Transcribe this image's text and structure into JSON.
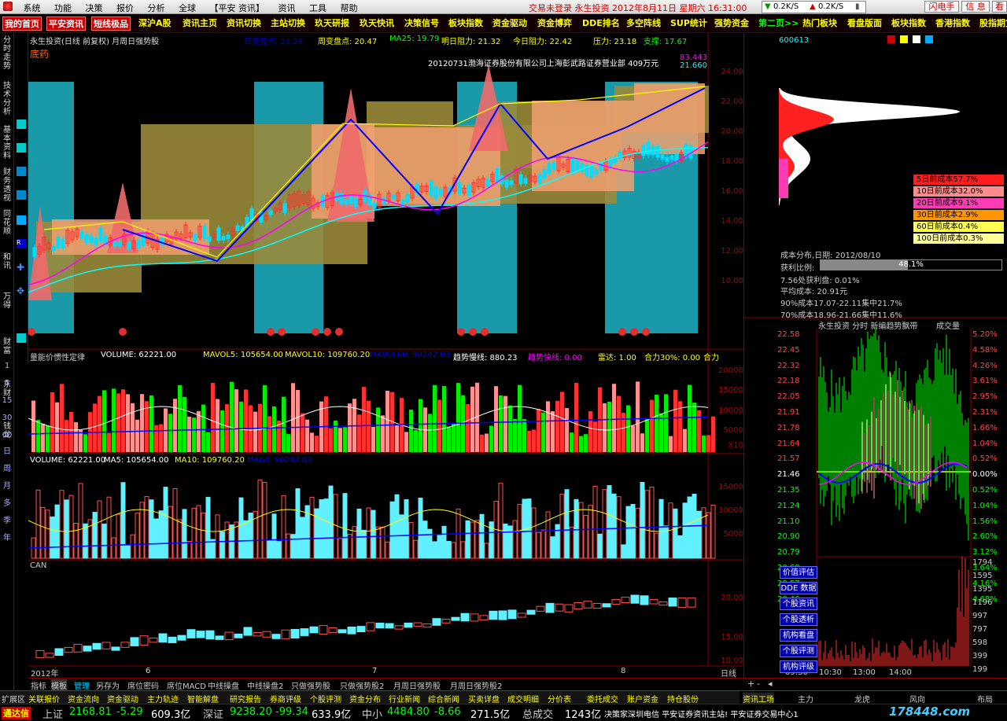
{
  "menu": {
    "items": [
      "系统",
      "功能",
      "决策",
      "报价",
      "分析",
      "全球",
      "【平安 资讯】",
      "资讯",
      "工具",
      "帮助"
    ],
    "status": "交易未登录  永生投资  2012年8月11日 星期六  16:31:00",
    "net_up": "0.2K/S",
    "net_down": "0.2K/S",
    "btn_flash": "闪电手",
    "btn_msg": "信 息",
    "btn_more": "看"
  },
  "toolbar": {
    "items": [
      "我的首页",
      "平安资讯",
      "短线极品",
      "深沪A股",
      "资讯主页",
      "资讯切换",
      "主站切换",
      "玖天研报",
      "玖天快讯",
      "决策信号",
      "板块指数",
      "资金驱动",
      "资金博弈",
      "DDE排名",
      "多空阵线",
      "SUP统计",
      "强势资金",
      "第二页>>",
      "热门板块",
      "看盘版面",
      "板块指数",
      "香港指数",
      "股指期货"
    ]
  },
  "left_tabs": [
    "分时走势",
    "技术分析",
    "基本资料",
    "财务透视",
    "同花顺",
    "和讯",
    "万得",
    "财富",
    "东财",
    "钱龙"
  ],
  "left_nums": [
    "1",
    "5",
    "15",
    "30",
    "60",
    "日",
    "周",
    "月",
    "多",
    "季",
    "年"
  ],
  "chart_header": {
    "title": "永生投资(日线 前复权) 月周日强势股",
    "sub": "底药",
    "daily": "日变盘点: 21.29",
    "weekly": "周变盘点: 20.47",
    "ma25": "MA25: 19.79",
    "resist_tomorrow": "明日阻力: 21.32",
    "resist_today": "今日阻力: 22.42",
    "pressure": "压力: 23.18",
    "support": "支撑: 17.67",
    "annotation": "20120731渤海证券股份有限公司上海彭武路证券营业部  409万元",
    "hi_label": "83.443",
    "hi2": "21.660"
  },
  "vol_header": {
    "label": "量能价惯性定律",
    "vol": "VOLUME: 62221.00",
    "mavol5": "MAVOL5: 105654.00",
    "mavol10": "MAVOL10: 109760.20",
    "mavol60": "MAVOL60: 90242.03",
    "slow": "趋势慢线: 880.23",
    "fast": "趋势快线: 0.00",
    "radar": "雷达: 1.00",
    "force": "合力30%: 0.00",
    "he": "合力"
  },
  "vol2_header": {
    "vol": "VOLUME: 62221.00",
    "ma5": "MA5: 105654.00",
    "ma10": "MA10: 109760.20",
    "ma60": "MA60: 90242.03"
  },
  "can_label": "CAN",
  "x_axis": {
    "year": "2012年",
    "m6": "6",
    "m7": "7",
    "m8": "8",
    "unit": "日线"
  },
  "price_axis": [
    "24.00",
    "22.00",
    "20.00",
    "18.00",
    "16.00",
    "14.00",
    "12.00",
    "10.00"
  ],
  "vol_axis": [
    "20000",
    "15000",
    "10000",
    "5000",
    "X10"
  ],
  "vol2_axis": [
    "15000",
    "10000",
    "5000"
  ],
  "can_axis": [
    "20.00",
    "15.00",
    "10.00"
  ],
  "right_panel": {
    "code": "600613",
    "cost_legend": [
      "5日前成本57.7%",
      "10日前成本32.0%",
      "20日前成本9.1%",
      "30日前成本2.9%",
      "60日前成本0.4%",
      "100日前成本0.3%"
    ],
    "cost_colors": [
      "#ff1e1e",
      "#ff8c8c",
      "#ff3cb4",
      "#ff9600",
      "#ffff50",
      "#ffff96"
    ],
    "dist_date": "成本分布,日期: 2012/08/10",
    "profit_label": "获利比例:",
    "profit_ratio": "48.1%",
    "line1": "7.56处获利盘: 0.01%",
    "line2": "平均成本: 20.91元",
    "line3": "90%成本17.07-22.11集中21.7%",
    "line4": "70%成本18.96-21.66集中11.6%",
    "mini_title": "永生投资  分时  新编趋势飘带",
    "mini_sub": "成交量",
    "mini_left": [
      "22.58",
      "22.45",
      "22.32",
      "22.18",
      "22.05",
      "21.91",
      "21.78",
      "21.64",
      "21.57",
      "21.46",
      "21.35",
      "21.24",
      "21.10",
      "20.90",
      "20.79",
      "20.68",
      "20.57",
      "20.46"
    ],
    "mini_right": [
      "5.20%",
      "4.58%",
      "4.26%",
      "3.61%",
      "2.95%",
      "2.31%",
      "1.66%",
      "1.04%",
      "0.52%",
      "0.00%",
      "0.52%",
      "1.04%",
      "1.56%",
      "2.60%",
      "3.12%",
      "3.64%",
      "4.16%",
      "4.68%"
    ],
    "vol_right": [
      "1794",
      "1595",
      "1395",
      "1196",
      "997",
      "797",
      "598",
      "399",
      "199"
    ],
    "time_axis": [
      "09:30",
      "10:30",
      "13:00",
      "14:00"
    ],
    "buttons": [
      "价值评估",
      "DDE 数据",
      "个股资讯",
      "个股透析",
      "机构看盘",
      "个股评测",
      "机构评级"
    ]
  },
  "bottom_tabs": [
    "指标",
    "模板",
    "管理",
    "另存为",
    "席位密码",
    "席位MACD",
    "中线操盘",
    "中线操盘2",
    "只做强势股",
    "只做强势股2",
    "月周日强势股",
    "月周日强势股2"
  ],
  "row2": [
    "扩展区",
    "关联报价",
    "资金流向",
    "资金驱动",
    "主力轨迹",
    "智能解盘",
    "研究报告",
    "券商评级",
    "个股评测",
    "资金分布",
    "行业新闻",
    "综合新闻",
    "买卖详盘",
    "成交明细",
    "分价表",
    "委托成交",
    "账户资金",
    "持仓股份"
  ],
  "right_tabs": [
    "资讯工场",
    "主力",
    "龙虎",
    "风向",
    "布局"
  ],
  "status_bar": {
    "logo": "通达信",
    "sh_label": "上证",
    "sh_val": "2168.81",
    "sh_chg": "-5.29",
    "sh_amt": "609.3亿",
    "sz_label": "深证",
    "sz_val": "9238.20",
    "sz_chg": "-99.34",
    "sz_amt": "633.9亿",
    "zx_label": "中小",
    "zx_val": "4484.80",
    "zx_chg": "-8.66",
    "zx_amt": "271.5亿",
    "total_label": "总成交",
    "total_val": "1243亿",
    "msg": "决策家深圳电信  平安证券资讯主站!  平安证券交易中心1",
    "watermark": "178448.com"
  }
}
